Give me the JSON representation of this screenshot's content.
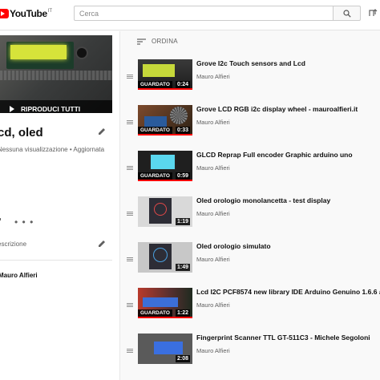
{
  "header": {
    "logo_text": "YouTube",
    "logo_suffix": "IT",
    "search_placeholder": "Cerca"
  },
  "playlist": {
    "play_all_label": "RIPRODUCI TUTTI",
    "title": "cd, oled",
    "meta": "Nessuna visualizzazione • Aggiornata",
    "more": "• • •",
    "description_label": "escrizione",
    "owner": "Mauro Alfieri"
  },
  "sort": {
    "label": "ORDINA"
  },
  "videos": [
    {
      "title": "Grove I2c Touch sensors and Lcd",
      "author": "Mauro Alfieri",
      "duration": "0:24",
      "watched": "GUARDATO"
    },
    {
      "title": "Grove LCD RGB i2c display wheel - mauroalfieri.it",
      "author": "Mauro Alfieri",
      "duration": "0:33",
      "watched": "GUARDATO"
    },
    {
      "title": "GLCD Reprap Full encoder Graphic arduino uno",
      "author": "Mauro Alfieri",
      "duration": "0:59",
      "watched": "GUARDATO"
    },
    {
      "title": "Oled orologio monolancetta - test display",
      "author": "Mauro Alfieri",
      "duration": "1:19",
      "watched": ""
    },
    {
      "title": "Oled orologio simulato",
      "author": "Mauro Alfieri",
      "duration": "1:49",
      "watched": ""
    },
    {
      "title": "Lcd I2C PCF8574 new library IDE Arduino Genuino 1.6.6 a",
      "author": "Mauro Alfieri",
      "duration": "1:22",
      "watched": "GUARDATO"
    },
    {
      "title": "Fingerprint Scanner TTL GT-511C3 - Michele Segoloni",
      "author": "Mauro Alfieri",
      "duration": "2:08",
      "watched": ""
    }
  ],
  "colors": {
    "brand": "#ff0000",
    "background": "#f9f9f9",
    "secondary_text": "#606060"
  }
}
